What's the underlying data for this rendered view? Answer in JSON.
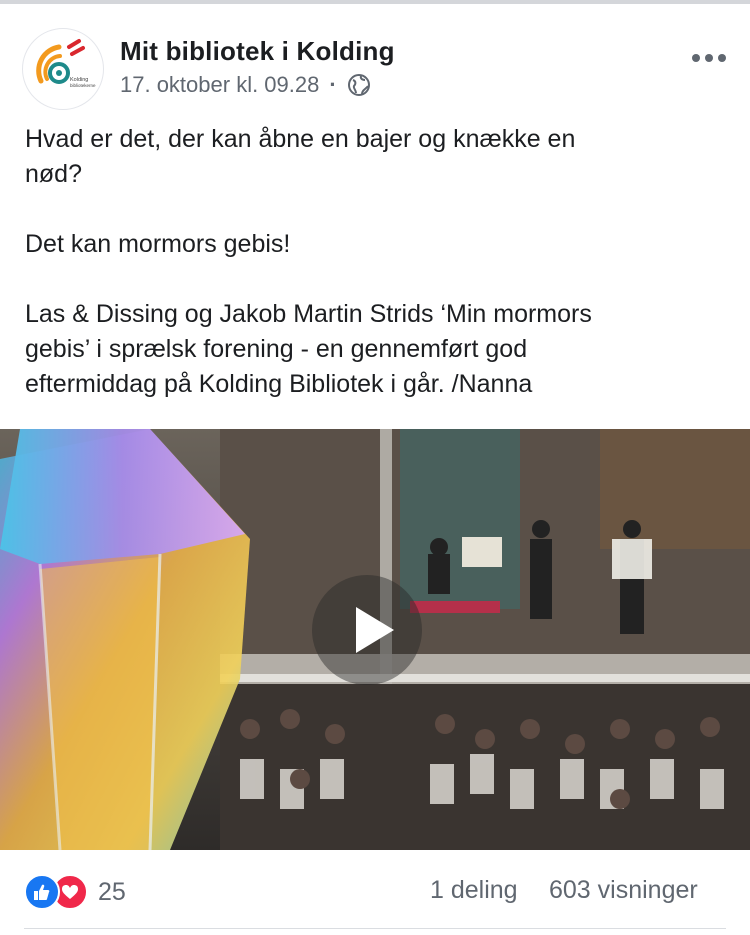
{
  "post": {
    "page_name": "Mit bibliotek i Kolding",
    "timestamp": "17. oktober kl. 09.28",
    "separator": "·",
    "avatar_logo_text": "Kolding\nbibliotekerne",
    "text_paragraphs": [
      "Hvad er det, der kan åbne en bajer og knække en\nnød?",
      "Det kan mormors gebis!",
      "Las & Dissing og Jakob Martin Strids ‘Min mormors\ngebis’ i sprælsk forening - en gennemført god\neftermiddag på Kolding Bibliotek i går. /Nanna"
    ]
  },
  "footer": {
    "reaction_count": "25",
    "shares": "1 deling",
    "views": "603 visninger"
  },
  "icons": {
    "privacy": "globe-icon",
    "menu": "more-icon",
    "video": "play-icon",
    "reaction_1": "like-icon",
    "reaction_2": "love-icon"
  },
  "colors": {
    "like": "#1877f2",
    "love": "#f0284a",
    "text": "#1c1e21",
    "secondary": "#606770",
    "logo_orange": "#f39a1e",
    "logo_teal": "#1e8a8a",
    "logo_red": "#d9272e"
  }
}
